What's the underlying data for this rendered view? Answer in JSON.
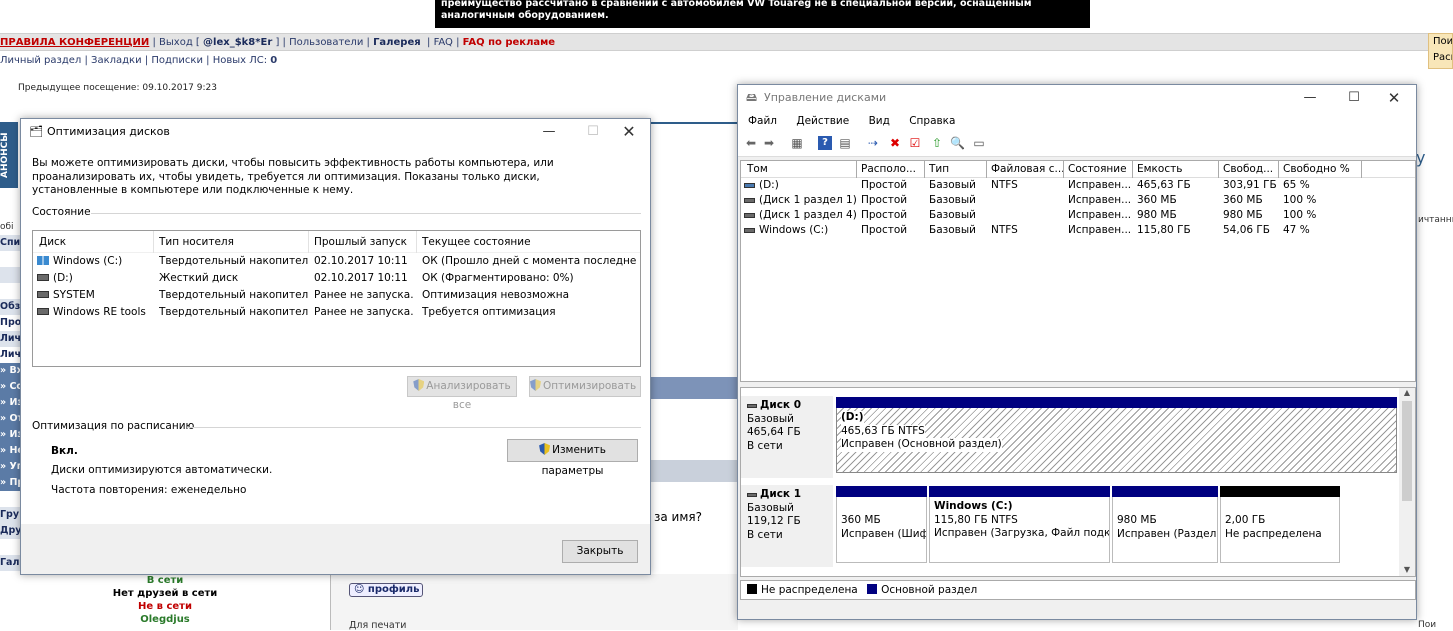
{
  "forum": {
    "banner_text": "преимущество рассчитано в сравнении с автомобилем VW Touareg не в специальной версии, оснащенным аналогичным оборудованием.",
    "nav1": {
      "rules": "ПРАВИЛА КОНФЕРЕНЦИИ",
      "logout_prefix": "Выход [",
      "username": "@lex_$k8*Er",
      "logout_suffix": "]",
      "users": "Пользователи",
      "gallery": "Галерея",
      "faq": "FAQ",
      "faq_ads": "FAQ по рекламе"
    },
    "nav2": {
      "personal": "Личный раздел",
      "bookmarks": "Закладки",
      "subscriptions": "Подписки",
      "new_pm_label": "Новых ЛС:",
      "new_pm_count": "0"
    },
    "prev_visit": "Предыдущее посещение: 09.10.2017 9:23",
    "orange_box": [
      "Пои",
      "Расш"
    ],
    "anons": "АНОНСЫ",
    "left_small": "обі",
    "left_col": [
      "Спи",
      "",
      "",
      "",
      "Обз",
      "Про",
      "Лич",
      "Лич",
      "» Вх",
      "» Со",
      "» Из",
      "» От",
      "» Из",
      "» Не",
      "» Уп",
      "» Пр",
      "",
      "Гру",
      "Дру",
      "",
      "Гал"
    ],
    "right_edge": "ичтанным",
    "right_u": "y",
    "question_fragment": "за имя?",
    "online": {
      "in_net": "В сети",
      "no_friends": "Нет друзей в сети",
      "offline": "Не в сети",
      "user": "Olegdjus"
    },
    "profile_button": "профиль",
    "print_link": "Для печати",
    "bottom_right": "Пои"
  },
  "defrag": {
    "title": "Оптимизация дисков",
    "intro": "Вы можете оптимизировать диски, чтобы повысить эффективность работы  компьютера, или проанализировать их, чтобы увидеть, требуется ли оптимизация. Показаны только диски, установленные в компьютере или подключенные к нему.",
    "status_label": "Состояние",
    "columns": [
      "Диск",
      "Тип носителя",
      "Прошлый запуск",
      "Текущее состояние"
    ],
    "drives": [
      {
        "icon": "windows-drive-icon",
        "name": "Windows (C:)",
        "media": "Твердотельный накопитель",
        "last_run": "02.10.2017 10:11",
        "status": "ОК (Прошло дней с момента последне..."
      },
      {
        "icon": "drive-icon",
        "name": "(D:)",
        "media": "Жесткий диск",
        "last_run": "02.10.2017 10:11",
        "status": "ОК (Фрагментировано: 0%)"
      },
      {
        "icon": "drive-icon",
        "name": "SYSTEM",
        "media": "Твердотельный накопитель",
        "last_run": "Ранее не запуска...",
        "status": "Оптимизация невозможна"
      },
      {
        "icon": "drive-icon",
        "name": "Windows RE tools",
        "media": "Твердотельный накопитель",
        "last_run": "Ранее не запуска...",
        "status": "Требуется оптимизация"
      }
    ],
    "analyze_all": "Анализировать все",
    "optimize_all": "Оптимизировать все",
    "schedule_label": "Оптимизация по расписанию",
    "schedule_state": "Вкл.",
    "change_settings": "Изменить параметры",
    "auto_text": "Диски оптимизируются автоматически.",
    "frequency": "Частота повторения: еженедельно",
    "close": "Закрыть"
  },
  "diskmgmt": {
    "title": "Управление дисками",
    "menu": [
      "Файл",
      "Действие",
      "Вид",
      "Справка"
    ],
    "columns": [
      "Том",
      "Располо...",
      "Тип",
      "Файловая с...",
      "Состояние",
      "Емкость",
      "Свобод...",
      "Свободно %"
    ],
    "volumes": [
      {
        "name": "(D:)",
        "layout": "Простой",
        "type": "Базовый",
        "fs": "NTFS",
        "status": "Исправен...",
        "capacity": "465,63 ГБ",
        "free": "303,91 ГБ",
        "free_pct": "65 %"
      },
      {
        "name": "(Диск 1 раздел 1)",
        "layout": "Простой",
        "type": "Базовый",
        "fs": "",
        "status": "Исправен...",
        "capacity": "360 МБ",
        "free": "360 МБ",
        "free_pct": "100 %"
      },
      {
        "name": "(Диск 1 раздел 4)",
        "layout": "Простой",
        "type": "Базовый",
        "fs": "",
        "status": "Исправен...",
        "capacity": "980 МБ",
        "free": "980 МБ",
        "free_pct": "100 %"
      },
      {
        "name": "Windows (C:)",
        "layout": "Простой",
        "type": "Базовый",
        "fs": "NTFS",
        "status": "Исправен...",
        "capacity": "115,80 ГБ",
        "free": "54,06 ГБ",
        "free_pct": "47 %"
      }
    ],
    "disk0": {
      "name": "Диск 0",
      "type": "Базовый",
      "size": "465,64 ГБ",
      "state": "В сети",
      "part": {
        "label": "(D:)",
        "size": "465,63 ГБ NTFS",
        "status": "Исправен (Основной раздел)"
      }
    },
    "disk1": {
      "name": "Диск 1",
      "type": "Базовый",
      "size": "119,12 ГБ",
      "state": "В сети",
      "parts": [
        {
          "label": "",
          "size": "360 МБ",
          "status": "Исправен (Шиф"
        },
        {
          "label": "Windows  (C:)",
          "size": "115,80 ГБ NTFS",
          "status": "Исправен (Загрузка, Файл подкач"
        },
        {
          "label": "",
          "size": "980 МБ",
          "status": "Исправен (Раздел в"
        },
        {
          "label": "",
          "size": "2,00 ГБ",
          "status": "Не распределена"
        }
      ]
    },
    "legend": {
      "unallocated": "Не распределена",
      "primary": "Основной раздел"
    },
    "colors": {
      "primary": "#000080",
      "unallocated": "#000000"
    }
  }
}
